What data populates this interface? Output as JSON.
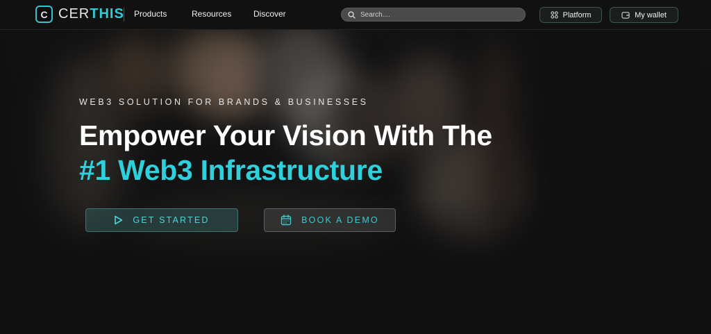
{
  "brand": {
    "logo_letter": "C",
    "name_part1": "CER",
    "name_part2": "THIS",
    "accent_color": "#35c9d3"
  },
  "nav": {
    "links": [
      {
        "label": "Products"
      },
      {
        "label": "Resources"
      },
      {
        "label": "Discover"
      }
    ],
    "search": {
      "placeholder": "Search....",
      "icon": "search-icon"
    },
    "platform_button": {
      "label": "Platform",
      "icon": "grid-icon"
    },
    "wallet_button": {
      "label": "My wallet",
      "icon": "wallet-icon"
    }
  },
  "hero": {
    "eyebrow": "WEB3 SOLUTION FOR BRANDS & BUSINESSES",
    "headline_line1": "Empower Your Vision With The",
    "headline_line2": "#1 Web3 Infrastructure",
    "headline_accent_color": "#2fd0dc",
    "primary_cta": {
      "label": "GET STARTED",
      "icon": "play-icon"
    },
    "secondary_cta": {
      "label": "BOOK A DEMO",
      "icon": "calendar-icon"
    }
  }
}
